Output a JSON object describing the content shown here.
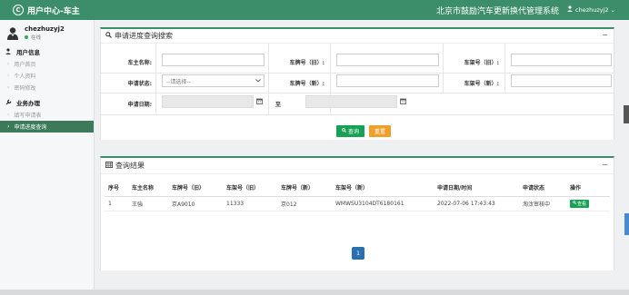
{
  "header": {
    "logo_glyph": "C",
    "app_title": "用户中心-车主",
    "system_title": "北京市鼓励汽车更新换代管理系统",
    "username": "chezhuzyj2",
    "user_caret": "⌄"
  },
  "sidebar": {
    "user_name": "chezhuzyj2",
    "status": "在线",
    "section_user": "用户信息",
    "user_items": [
      "用户首页",
      "个人资料",
      "密码修改"
    ],
    "section_biz": "业务办理",
    "biz_items": [
      "填写申请表",
      "申请进度查询"
    ],
    "active_item": "申请进度查询"
  },
  "search_panel": {
    "title": "申请进度查询搜索",
    "collapse": "−",
    "labels": {
      "owner_name": "车主名称:",
      "plate_old": "车牌号（旧）:",
      "frame_old": "车架号（旧）:",
      "status": "申请状态:",
      "plate_new": "车牌号（新）:",
      "frame_new": "车架号（新）:",
      "date": "申请日期:",
      "to": "至"
    },
    "status_placeholder": "--请选择--",
    "query_button": "查询",
    "reset_button": "重置"
  },
  "results_panel": {
    "title": "查询结果",
    "collapse": "−",
    "columns": [
      "序号",
      "车主名称",
      "车牌号（旧）",
      "车架号（旧）",
      "车牌号（新）",
      "车架号（新）",
      "申请日期/时间",
      "申请状态",
      "操作"
    ],
    "rows": [
      [
        "1",
        "王強",
        "京A9010",
        "11333",
        "京012",
        "WMWSU3104DT6180161",
        "2022-07-06 17:43:43",
        "淘汰审核中"
      ]
    ],
    "view_button": "查看",
    "page": "1"
  }
}
